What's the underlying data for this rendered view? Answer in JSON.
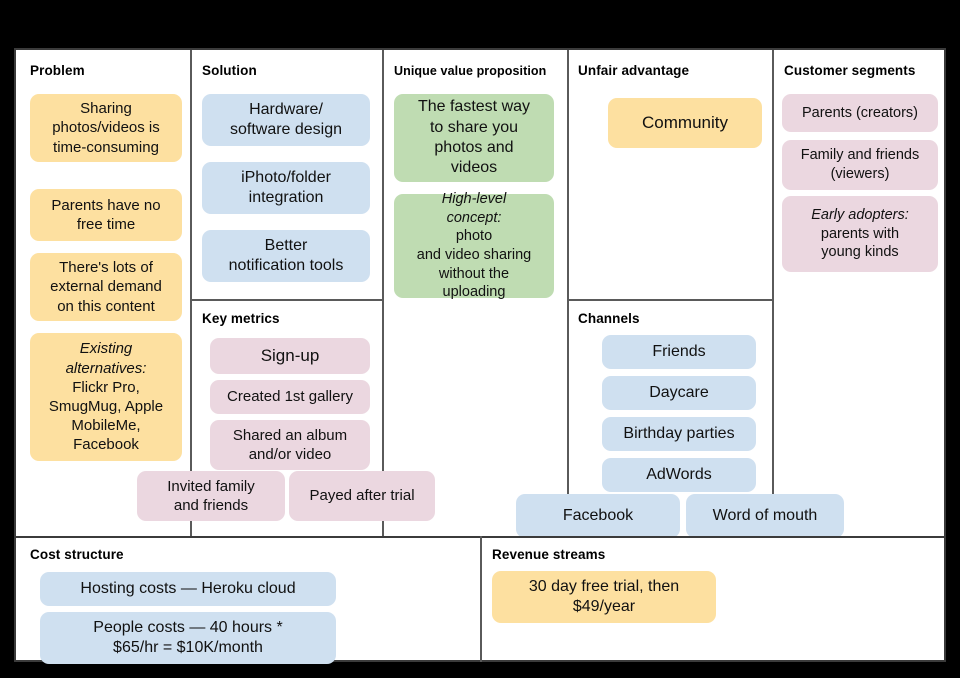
{
  "canvas": {
    "type": "lean-canvas",
    "colors": {
      "yellow": "#fde0a0",
      "blue": "#cfe0f0",
      "pink": "#ebd7e0",
      "green": "#bfdcb2",
      "frame": "#3b3b3b",
      "divider": "#5a5a5a",
      "background": "#000000",
      "surface": "#ffffff"
    }
  },
  "sections": {
    "problem": {
      "title": "Problem",
      "notes": [
        {
          "text": "Sharing\nphotos/videos is\ntime-consuming",
          "color": "yellow"
        },
        {
          "text": "Parents have no\nfree time",
          "color": "yellow"
        },
        {
          "text": "There's lots of\nexternal demand\non this content",
          "color": "yellow"
        },
        {
          "text_italic": "Existing\nalternatives:",
          "text": "Flickr Pro,\nSmugMug, Apple\nMobileMe,\nFacebook",
          "color": "yellow"
        }
      ]
    },
    "solution": {
      "title": "Solution",
      "notes": [
        {
          "text": "Hardware/\nsoftware design",
          "color": "blue"
        },
        {
          "text": "iPhoto/folder\nintegration",
          "color": "blue"
        },
        {
          "text": "Better\nnotification tools",
          "color": "blue"
        }
      ]
    },
    "key_metrics": {
      "title": "Key metrics",
      "notes": [
        {
          "text": "Sign-up",
          "color": "pink"
        },
        {
          "text": "Created 1st gallery",
          "color": "pink"
        },
        {
          "text": "Shared an album\nand/or video",
          "color": "pink"
        },
        {
          "text": "Invited family\nand friends",
          "color": "pink"
        },
        {
          "text": "Payed after trial",
          "color": "pink"
        }
      ]
    },
    "unique_value_proposition": {
      "title": "Unique value proposition",
      "notes": [
        {
          "text": "The fastest way\nto share you\nphotos and\nvideos",
          "color": "green"
        },
        {
          "text_italic": "High-level\nconcept:",
          "text": " photo\nand video sharing\nwithout the\nuploading",
          "color": "green"
        }
      ]
    },
    "unfair_advantage": {
      "title": "Unfair advantage",
      "notes": [
        {
          "text": "Community",
          "color": "yellow"
        }
      ]
    },
    "channels": {
      "title": "Channels",
      "notes": [
        {
          "text": "Friends",
          "color": "blue"
        },
        {
          "text": "Daycare",
          "color": "blue"
        },
        {
          "text": "Birthday parties",
          "color": "blue"
        },
        {
          "text": "AdWords",
          "color": "blue"
        },
        {
          "text": "Facebook",
          "color": "blue"
        },
        {
          "text": "Word of mouth",
          "color": "blue"
        }
      ]
    },
    "customer_segments": {
      "title": "Customer segments",
      "notes": [
        {
          "text": "Parents (creators)",
          "color": "pink"
        },
        {
          "text": "Family and friends\n(viewers)",
          "color": "pink"
        },
        {
          "text_italic": "Early adopters:",
          "text": "parents with\nyoung kinds",
          "color": "pink"
        }
      ]
    },
    "cost_structure": {
      "title": "Cost structure",
      "notes": [
        {
          "text": "Hosting costs — Heroku cloud",
          "color": "blue"
        },
        {
          "text": "People costs — 40 hours *\n$65/hr = $10K/month",
          "color": "blue"
        }
      ]
    },
    "revenue_streams": {
      "title": "Revenue streams",
      "notes": [
        {
          "text": "30 day free trial, then\n$49/year",
          "color": "yellow"
        }
      ]
    }
  }
}
